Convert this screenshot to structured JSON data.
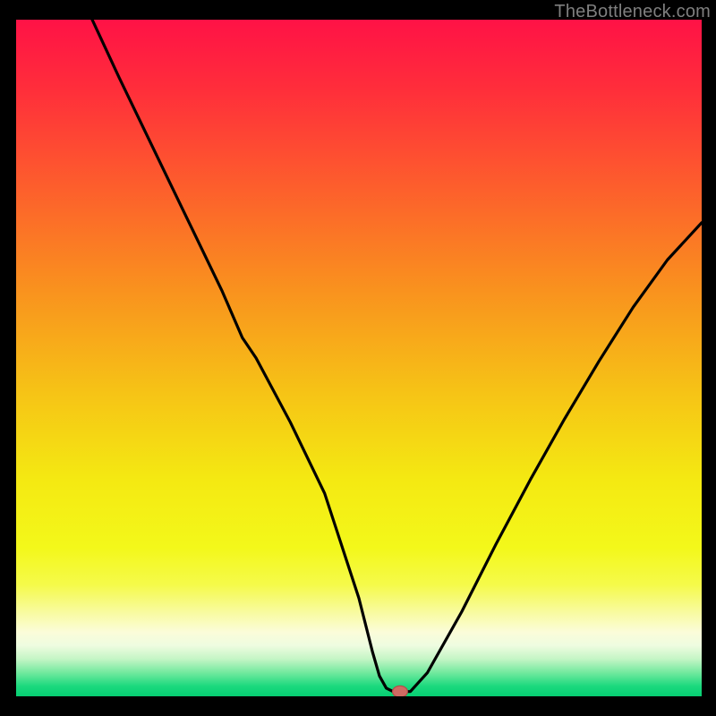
{
  "attribution": "TheBottleneck.com",
  "colors": {
    "bg": "#000000",
    "curve": "#000000",
    "marker_fill": "#cf6a63",
    "marker_stroke": "#b54a47",
    "gradient_stops": [
      {
        "offset": 0.0,
        "color": "#ff1246"
      },
      {
        "offset": 0.1,
        "color": "#ff2d3b"
      },
      {
        "offset": 0.25,
        "color": "#fd5f2c"
      },
      {
        "offset": 0.4,
        "color": "#f9921e"
      },
      {
        "offset": 0.55,
        "color": "#f6c316"
      },
      {
        "offset": 0.68,
        "color": "#f4e912"
      },
      {
        "offset": 0.78,
        "color": "#f3f81a"
      },
      {
        "offset": 0.835,
        "color": "#f5fa4a"
      },
      {
        "offset": 0.875,
        "color": "#f8fb9e"
      },
      {
        "offset": 0.905,
        "color": "#fbfcd9"
      },
      {
        "offset": 0.925,
        "color": "#eefce0"
      },
      {
        "offset": 0.945,
        "color": "#c4f5c5"
      },
      {
        "offset": 0.965,
        "color": "#72e99e"
      },
      {
        "offset": 0.985,
        "color": "#1bd97e"
      },
      {
        "offset": 1.0,
        "color": "#06cf72"
      }
    ]
  },
  "chart_data": {
    "type": "line",
    "title": "",
    "xlabel": "",
    "ylabel": "",
    "xlim": [
      0,
      100
    ],
    "ylim": [
      0,
      100
    ],
    "note": "Values estimated from pixel positions; chart has no visible axes or ticks.",
    "series": [
      {
        "name": "curve",
        "x": [
          11.1,
          15.0,
          20.0,
          25.0,
          30.0,
          33.0,
          35.0,
          40.0,
          45.0,
          50.0,
          52.0,
          53.0,
          54.0,
          55.0,
          56.0,
          57.5,
          60.0,
          65.0,
          70.0,
          75.0,
          80.0,
          85.0,
          90.0,
          95.0,
          100.0
        ],
        "y": [
          100.0,
          91.5,
          81.0,
          70.5,
          60.0,
          53.0,
          50.0,
          40.5,
          30.0,
          14.5,
          6.5,
          3.0,
          1.2,
          0.7,
          0.7,
          0.7,
          3.5,
          12.5,
          22.5,
          32.0,
          41.0,
          49.5,
          57.5,
          64.5,
          70.0
        ]
      }
    ],
    "marker": {
      "x": 56.0,
      "y": 0.7
    }
  }
}
